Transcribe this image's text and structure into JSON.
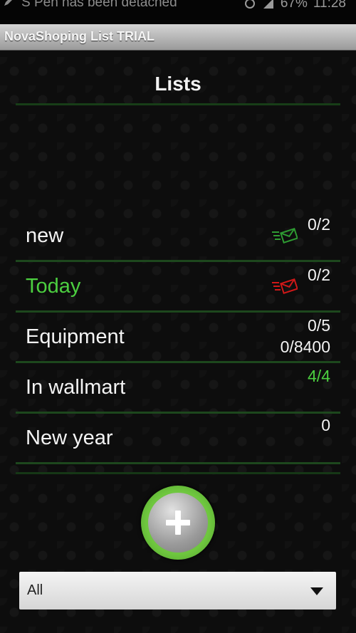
{
  "status_bar": {
    "notification": "S Pen has been detached",
    "battery": "67%",
    "time": "11:28"
  },
  "app": {
    "title": "NovaShoping List TRIAL"
  },
  "header": {
    "title": "Lists"
  },
  "lists": [
    {
      "name": "new",
      "count": "0/2",
      "extra": "",
      "mail_icon": "green-mail-icon",
      "highlight": false
    },
    {
      "name": "Today",
      "count": "0/2",
      "extra": "",
      "mail_icon": "red-mail-icon",
      "highlight": true
    },
    {
      "name": "Equipment",
      "count": "0/5",
      "extra": "0/8400",
      "mail_icon": "",
      "highlight": false
    },
    {
      "name": "In wallmart",
      "count": "4/4",
      "extra": "",
      "mail_icon": "",
      "highlight": false
    },
    {
      "name": "New year",
      "count": "0",
      "extra": "",
      "mail_icon": "",
      "highlight": false
    }
  ],
  "filter": {
    "selected": "All"
  },
  "colors": {
    "accent_green": "#4ccf40",
    "mail_green": "#2e9b32",
    "mail_red": "#d01818",
    "separator": "#1d471d"
  }
}
